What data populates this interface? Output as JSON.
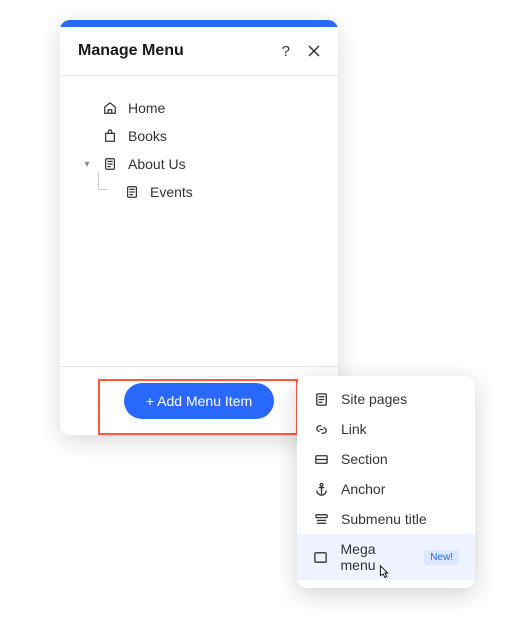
{
  "panel": {
    "title": "Manage Menu"
  },
  "tree": {
    "items": [
      {
        "label": "Home"
      },
      {
        "label": "Books"
      },
      {
        "label": "About Us",
        "children": [
          {
            "label": "Events"
          }
        ]
      }
    ]
  },
  "footer": {
    "add_label": "+ Add Menu Item"
  },
  "dropdown": {
    "items": [
      {
        "label": "Site pages"
      },
      {
        "label": "Link"
      },
      {
        "label": "Section"
      },
      {
        "label": "Anchor"
      },
      {
        "label": "Submenu title"
      },
      {
        "label": "Mega menu",
        "badge": "New!"
      }
    ]
  }
}
